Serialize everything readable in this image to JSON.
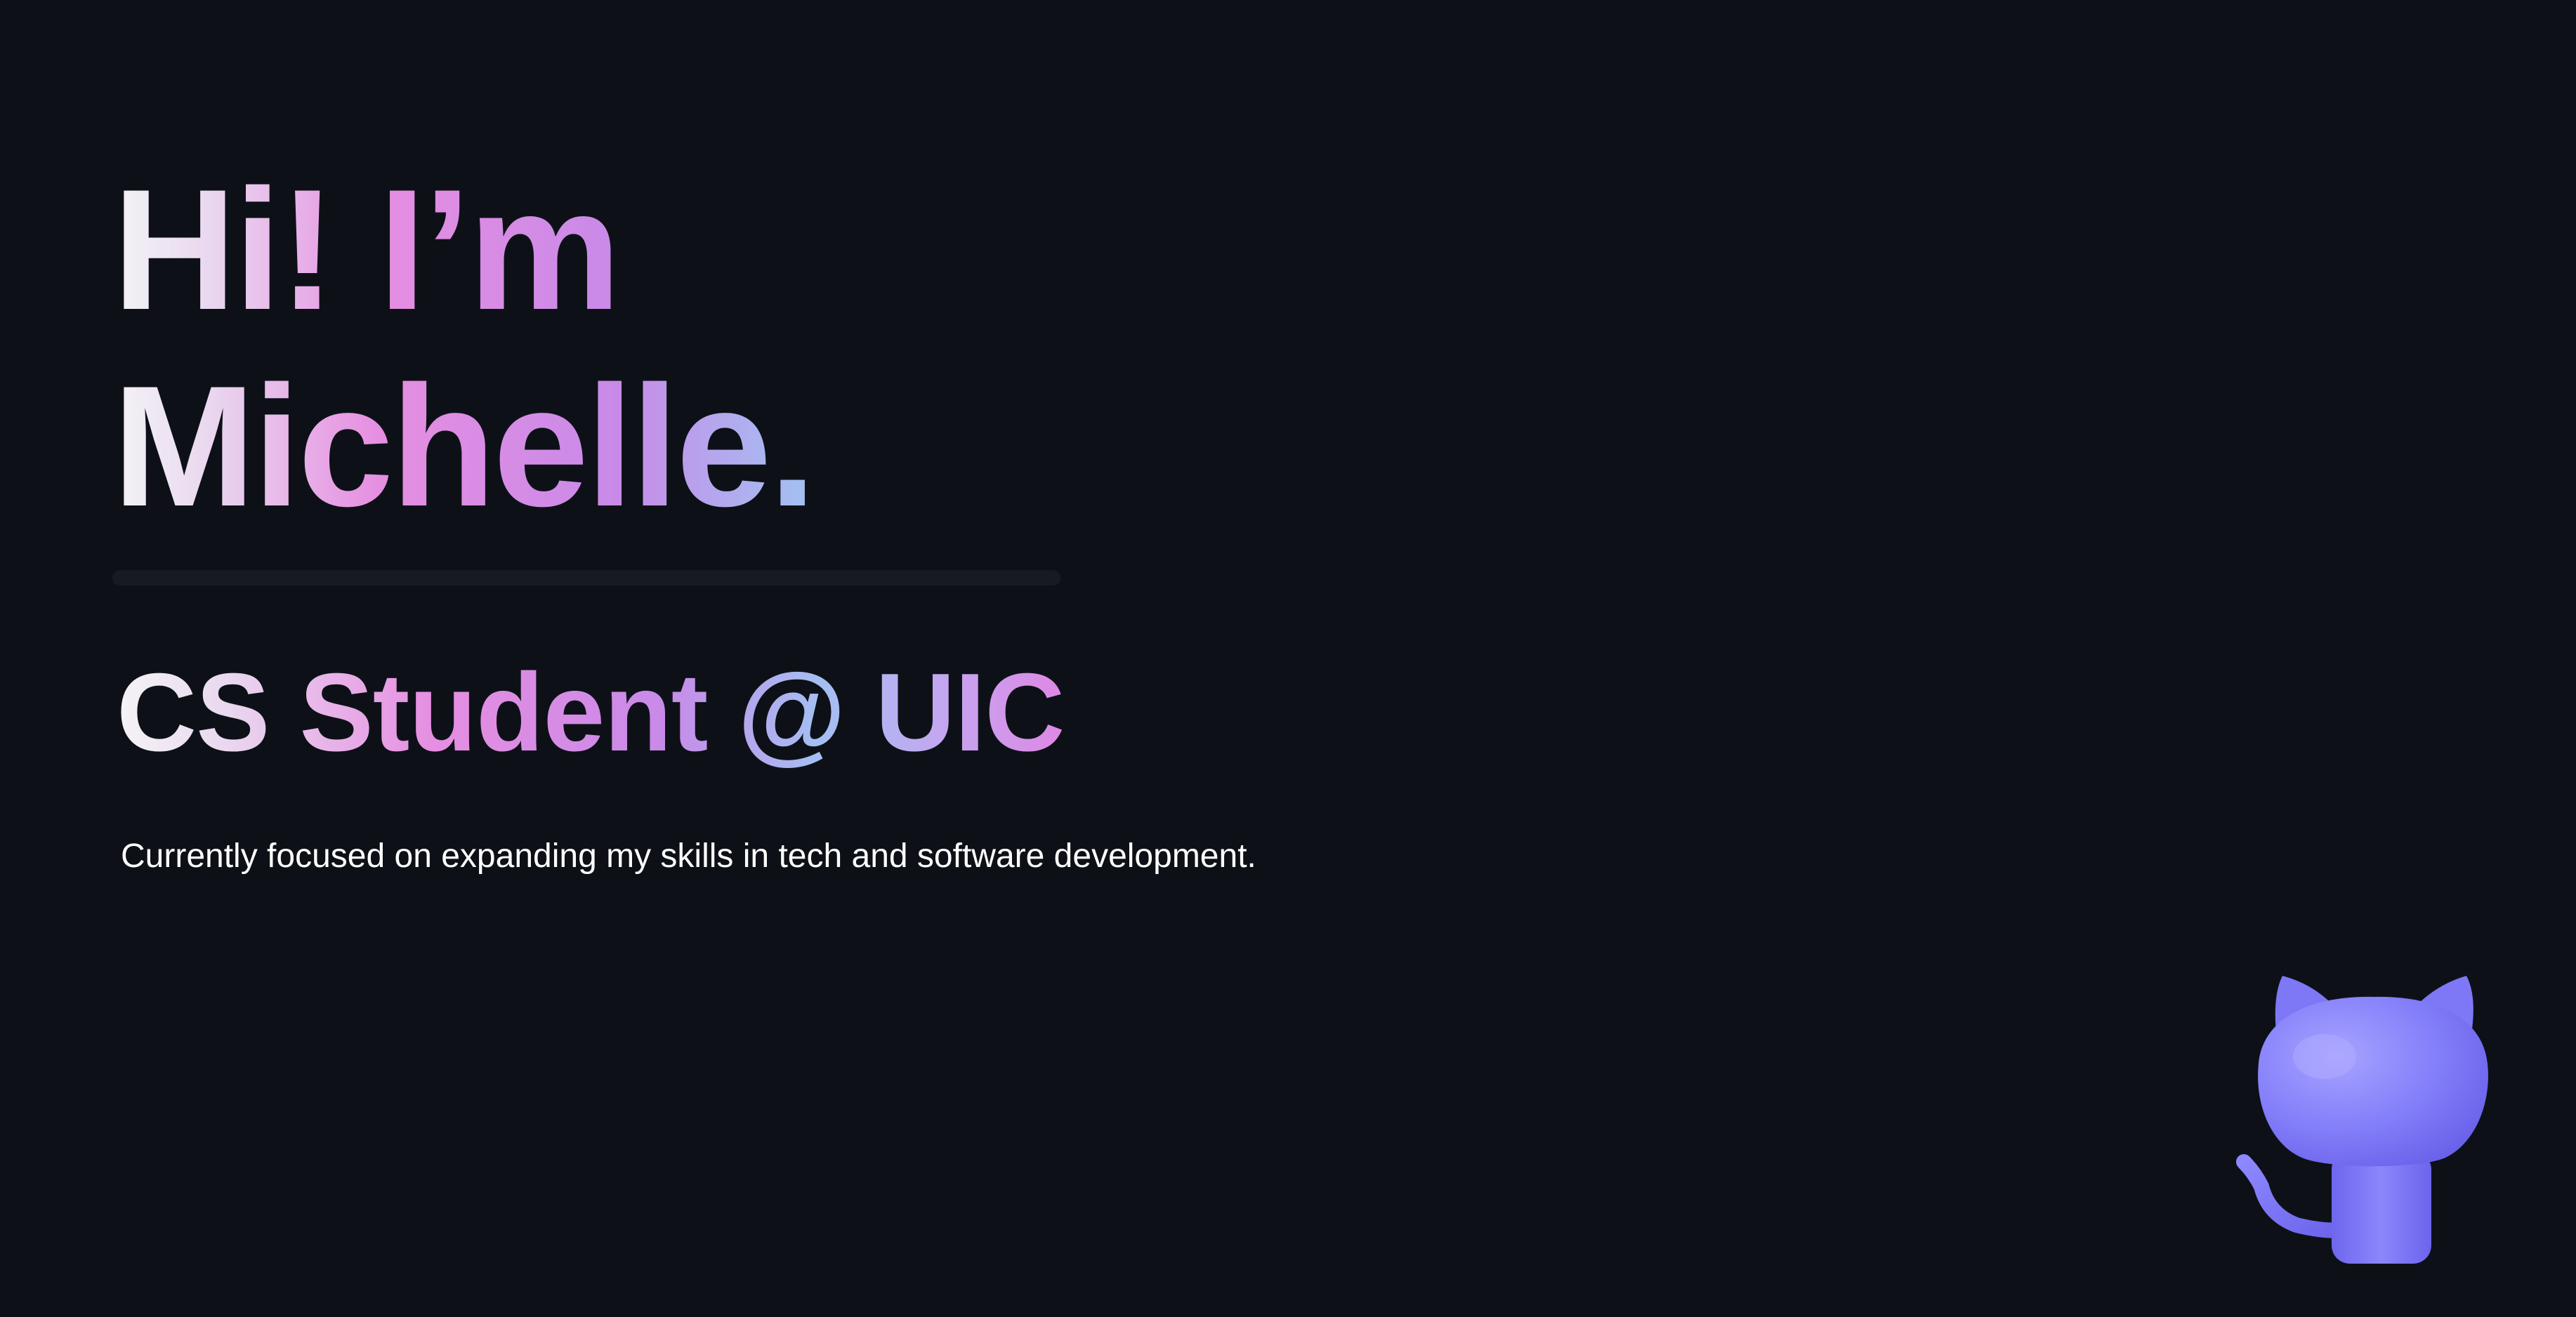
{
  "hero": {
    "headline_line1": "Hi! I’m",
    "headline_line2": "Michelle.",
    "role": "CS Student @ UIC",
    "tagline": "Currently focused on expanding my skills in tech and software development."
  },
  "colors": {
    "background": "#0d1117",
    "divider": "#161b22",
    "gradient_stops": [
      "#f4f4f6",
      "#e68ee1",
      "#c88ae8",
      "#a4bff2",
      "#e77ee2"
    ],
    "mascot": "#7b73f7"
  },
  "mascot": {
    "icon": "octocat-icon"
  }
}
